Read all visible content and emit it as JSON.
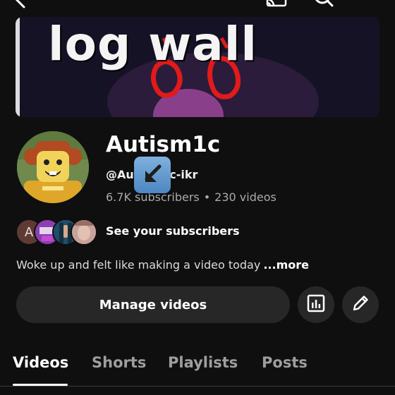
{
  "banner": {
    "text": "log wall"
  },
  "channel": {
    "name": "Autism1c",
    "handle": "@Autism1c-ikr",
    "subscribers": "6.7K subscribers",
    "separator": "•",
    "videos": "230 videos"
  },
  "subscribers_row": {
    "first_initial": "A",
    "label": "See your subscribers"
  },
  "description": {
    "text": "Woke up and felt like making a video today",
    "more": "...more"
  },
  "actions": {
    "manage_label": "Manage videos",
    "analytics_icon": "analytics-icon",
    "edit_icon": "pencil-icon"
  },
  "tabs": [
    {
      "label": "Videos",
      "active": true
    },
    {
      "label": "Shorts",
      "active": false
    },
    {
      "label": "Playlists",
      "active": false
    },
    {
      "label": "Posts",
      "active": false
    }
  ],
  "colors": {
    "background": "#0f0f0f",
    "button": "#272727",
    "secondary_text": "#aaaaaa"
  }
}
